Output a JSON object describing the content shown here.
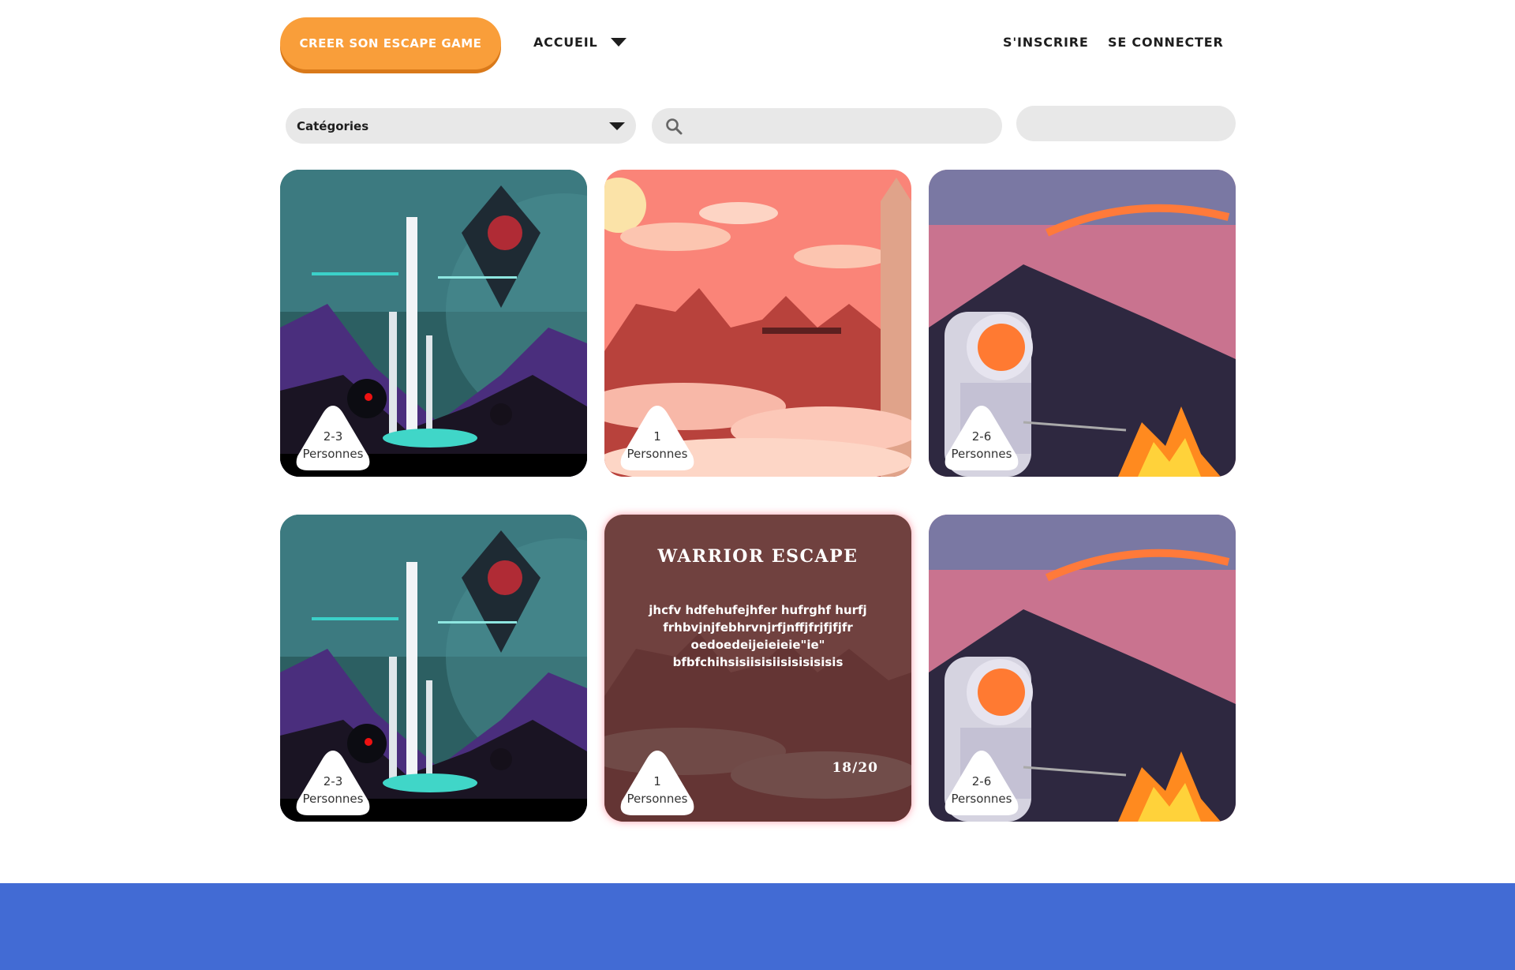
{
  "header": {
    "create_button": "CREER SON ESCAPE GAME",
    "nav_home": "ACCUEIL",
    "nav_signup": "S'INSCRIRE",
    "nav_login": "SE CONNECTER"
  },
  "filters": {
    "categories_label": "Catégories",
    "search_value": "",
    "extra_value": ""
  },
  "cards": [
    {
      "players": "2-3",
      "unit": "Personnes",
      "art": "space"
    },
    {
      "players": "1",
      "unit": "Personnes",
      "art": "sky"
    },
    {
      "players": "2-6",
      "unit": "Personnes",
      "art": "astronaut"
    },
    {
      "players": "2-3",
      "unit": "Personnes",
      "art": "space"
    },
    {
      "players": "1",
      "unit": "Personnes",
      "art": "sky",
      "title": "WARRIOR ESCAPE",
      "description": "jhcfv hdfehufejhfer hufrghf hurfj frhbvjnjfebhrvnjrfjnffjfrjfjfjfr oedoedeijeieieie\"ie\" bfbfchihsisiisisiisisisisisis",
      "score": "18/20"
    },
    {
      "players": "2-6",
      "unit": "Personnes",
      "art": "astronaut"
    }
  ],
  "colors": {
    "accent": "#f99e3a",
    "footer": "#426bd4",
    "field": "#e8e8e8"
  }
}
